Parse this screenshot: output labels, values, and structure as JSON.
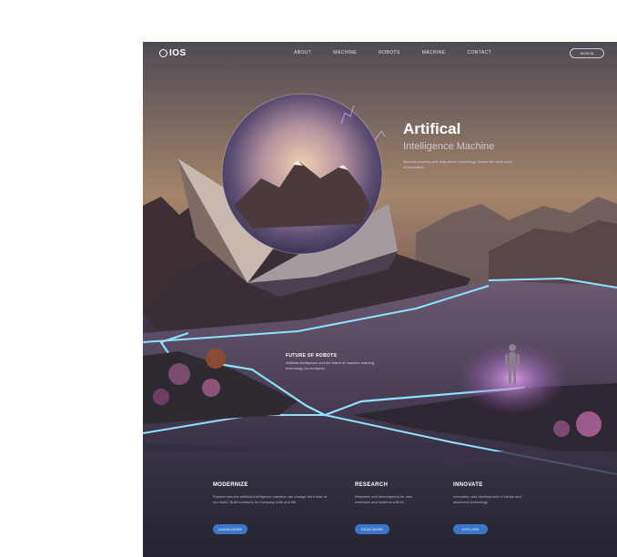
{
  "logo": {
    "text": "IOS"
  },
  "nav": {
    "items": [
      "ABOUT",
      "MACHINE",
      "ROBOTS",
      "MACHINE",
      "CONTACT"
    ],
    "button_label": "SIGN IN"
  },
  "hero": {
    "title": "Artifical",
    "subtitle": "Intelligence Machine",
    "description": "Machine learning and data-driven technology. Create the next world of innovation."
  },
  "middle": {
    "title": "FUTURE OF ROBOTS",
    "description": "Artificial intelligence and the future of machine learning technology for everyone."
  },
  "columns": [
    {
      "title": "MODERNIZE",
      "description": "Explore how the artificial intelligence machine can change the future of our world. Build solutions for everyday work and life.",
      "button": "LEARN MORE"
    },
    {
      "title": "RESEARCH",
      "description": "Research and development for new machines and systems with AI.",
      "button": "READ MORE"
    },
    {
      "title": "INNOVATE",
      "description": "Innovation and development of robots and advanced technology.",
      "button": "EXPLORE"
    }
  ],
  "colors": {
    "accent": "#3c76c8",
    "river_glow": "#8fe1ff",
    "figure_glow": "#c77bd6"
  }
}
